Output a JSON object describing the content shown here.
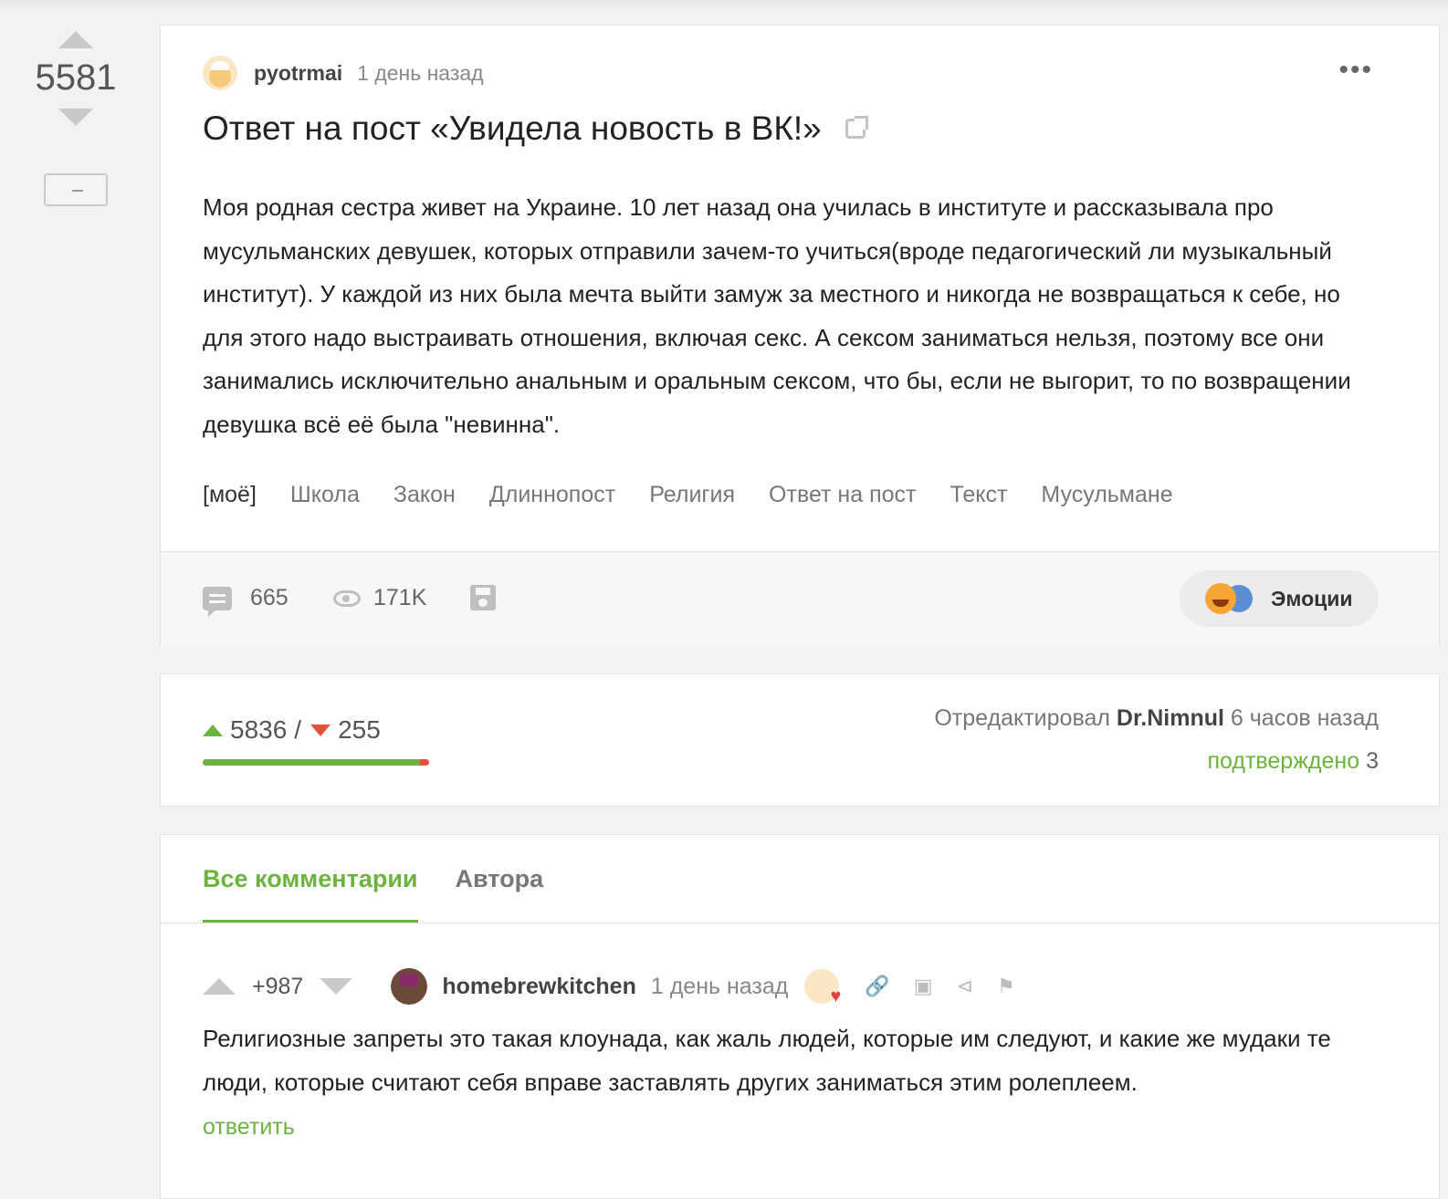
{
  "rail": {
    "score": "5581"
  },
  "post": {
    "author": "pyotrmai",
    "time": "1 день назад",
    "title": "Ответ на пост «Увидела новость в ВК!»",
    "body": "Моя родная сестра живет на Украине. 10 лет назад она училась в институте и рассказывала про мусульманских девушек, которых отправили зачем-то учиться(вроде педагогический ли музыкальный институт). У каждой из них была мечта выйти замуж за местного и никогда не возвращаться к себе, но для этого надо выстраивать отношения, включая секс. А сексом заниматься нельзя, поэтому все они занимались исключительно анальным и оральным сексом, что бы, если не выгорит, то по возвращении девушка всё её была \"невинна\".",
    "tags": [
      "[моё]",
      "Школа",
      "Закон",
      "Длиннопост",
      "Религия",
      "Ответ на пост",
      "Текст",
      "Мусульмане"
    ],
    "comments_count": "665",
    "views": "171K",
    "emotions_label": "Эмоции",
    "icons": {
      "more": "more-dots-icon",
      "external": "external-link-icon",
      "comments": "comment-icon",
      "views": "eye-icon",
      "save": "save-icon"
    }
  },
  "rating": {
    "up": "5836",
    "separator": "/",
    "down": "255",
    "bar_fraction_up": 0.958,
    "edited_prefix": "Отредактировал",
    "editor": "Dr.Nimnul",
    "edited_time": "6 часов назад",
    "confirmed_label": "подтверждено",
    "confirmed_count": "3",
    "colors": {
      "up": "#6db33f",
      "down": "#e8503a"
    }
  },
  "comments": {
    "tabs": [
      "Все комментарии",
      "Автора"
    ],
    "active_tab": 0,
    "items": [
      {
        "score": "+987",
        "author": "homebrewkitchen",
        "time": "1 день назад",
        "text": "Религиозные запреты это такая клоунада, как жаль людей, которые им следуют, и какие же мудаки те люди, которые считают себя вправе заставлять других заниматься этим ролеплеем.",
        "reply_label": "ответить",
        "action_icons": [
          "link-icon",
          "save-icon",
          "share-icon",
          "flag-icon"
        ]
      }
    ]
  }
}
